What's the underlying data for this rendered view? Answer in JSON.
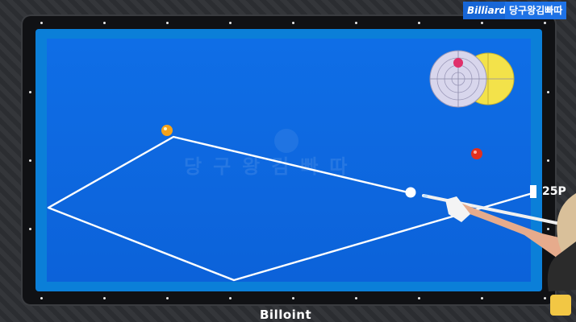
{
  "channel": {
    "badge_left": "Billiards",
    "badge_right": "당구왕김빠따"
  },
  "watermark": {
    "text": "당구왕김빠따"
  },
  "score": {
    "value": "25P"
  },
  "brand": {
    "logo_text": "Billoint"
  },
  "colors": {
    "cloth": "#0f6ee6",
    "rail": "#101114",
    "cue_ball": "#ffffff",
    "yellow_ball": "#f5a21a",
    "red_ball": "#e0301f",
    "path_line": "#ffffff",
    "diagram_left": "#d8d6ec",
    "diagram_right": "#f3e24a"
  },
  "icons": {
    "avatar": "channel-avatar-icon",
    "watermark": "mascot-icon"
  }
}
